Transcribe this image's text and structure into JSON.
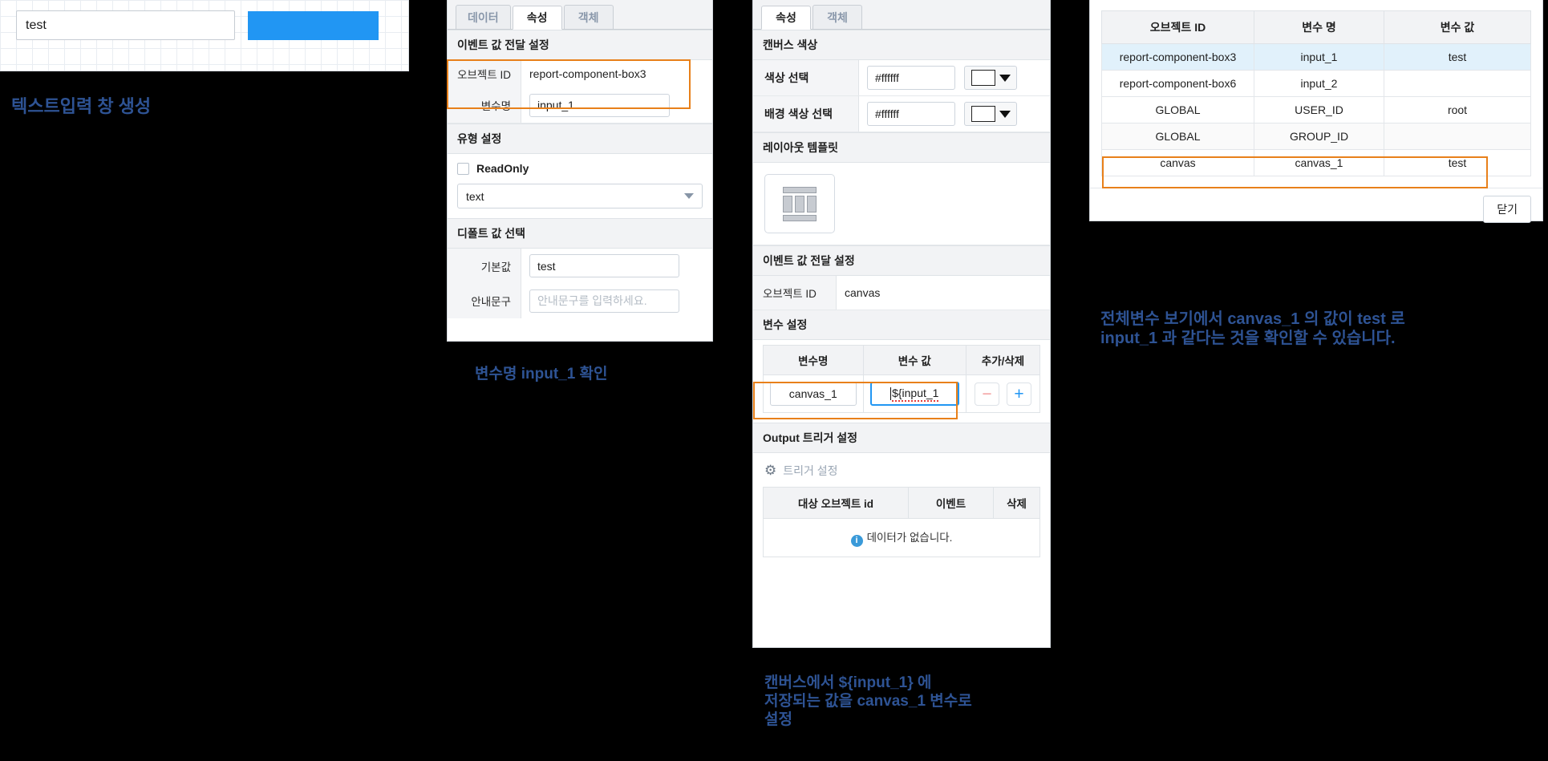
{
  "canvas_preview": {
    "input_value": "test",
    "button_label": ""
  },
  "panel_component": {
    "tabs": [
      {
        "label": "데이터",
        "active": false
      },
      {
        "label": "속성",
        "active": true
      },
      {
        "label": "객체",
        "active": false
      }
    ],
    "event_section_title": "이벤트 값 전달 설정",
    "object_id_label": "오브젝트 ID",
    "object_id_value": "report-component-box3",
    "var_name_label": "변수명",
    "var_name_value": "input_1",
    "type_section_title": "유형 설정",
    "readonly_label": "ReadOnly",
    "readonly_checked": false,
    "type_select_value": "text",
    "default_section_title": "디폴트 값 선택",
    "default_value_label": "기본값",
    "default_value": "test",
    "guide_label": "안내문구",
    "guide_placeholder": "안내문구를 입력하세요."
  },
  "panel_canvas": {
    "tabs": [
      {
        "label": "속성",
        "active": true
      },
      {
        "label": "객체",
        "active": false
      }
    ],
    "color_section_title": "캔버스 색상",
    "color_rows": [
      {
        "label": "색상 선택",
        "hex": "#ffffff"
      },
      {
        "label": "배경 색상 선택",
        "hex": "#ffffff"
      }
    ],
    "layout_section_title": "레이아웃 템플릿",
    "layout_icon": "layout-template-icon",
    "event_section_title": "이벤트 값 전달 설정",
    "object_id_label": "오브젝트 ID",
    "object_id_value": "canvas",
    "var_section_title": "변수 설정",
    "var_table": {
      "headers": [
        "변수명",
        "변수 값",
        "추가/삭제"
      ],
      "rows": [
        {
          "name": "canvas_1",
          "value": "${input_1",
          "minus": "−",
          "plus": "+"
        }
      ]
    },
    "output_section_title": "Output 트리거 설정",
    "trigger_link": "트리거 설정",
    "trigger_icon": "gear-icon",
    "output_table": {
      "headers": [
        "대상 오브젝트 id",
        "이벤트",
        "삭제"
      ],
      "empty_text": "데이터가 없습니다."
    }
  },
  "panel_variables": {
    "headers": [
      "오브젝트 ID",
      "변수 명",
      "변수 값"
    ],
    "rows": [
      {
        "object_id": "report-component-box3",
        "var_name": "input_1",
        "var_value": "test",
        "state": "selected"
      },
      {
        "object_id": "report-component-box6",
        "var_name": "input_2",
        "var_value": "",
        "state": "normal"
      },
      {
        "object_id": "GLOBAL",
        "var_name": "USER_ID",
        "var_value": "root",
        "state": "normal"
      },
      {
        "object_id": "GLOBAL",
        "var_name": "GROUP_ID",
        "var_value": "",
        "state": "alt"
      },
      {
        "object_id": "canvas",
        "var_name": "canvas_1",
        "var_value": "test",
        "state": "highlighted"
      }
    ],
    "close_label": "닫기"
  },
  "annotations": {
    "note1": "텍스트입력 창 생성",
    "note2": "변수명 input_1 확인",
    "note3_line1": "캔버스에서 ${input_1} 에",
    "note3_line2": "저장되는 값을 canvas_1 변수로",
    "note3_line3": "설정",
    "note4_line1": "전체변수 보기에서 canvas_1 의 값이 test 로",
    "note4_line2": "input_1 과 같다는 것을 확인할 수 있습니다."
  },
  "colors": {
    "accent_blue": "#2196f3",
    "highlight_orange": "#e8801a",
    "note_blue": "#2e5394",
    "row_selected": "#e1f1fb"
  }
}
